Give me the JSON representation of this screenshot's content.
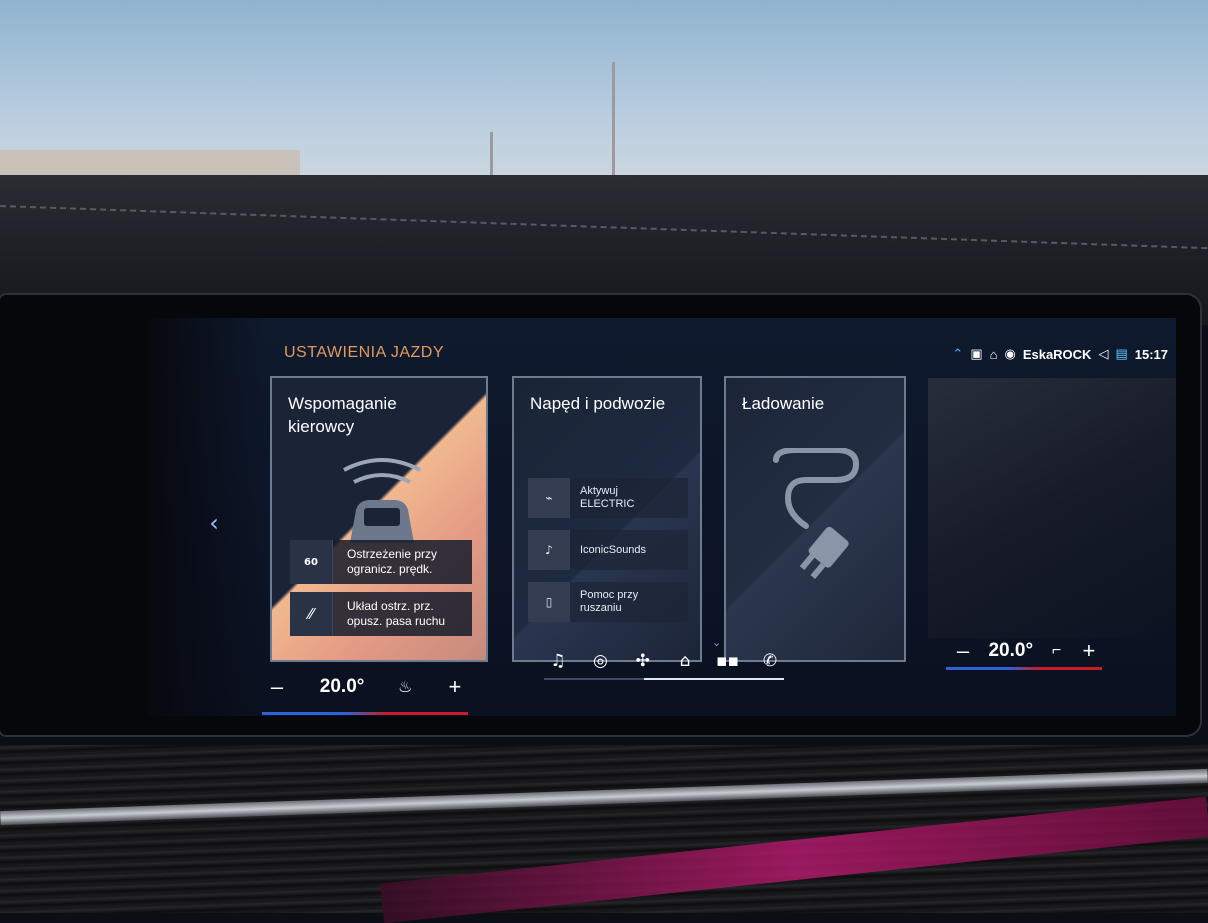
{
  "header": {
    "title": "USTAWIENIA JAZDY"
  },
  "status_bar": {
    "icons": [
      "connectivity-icon",
      "notification-icon",
      "car-icon",
      "radio-icon"
    ],
    "radio_station": "EskaROCK",
    "volume_icon": "speaker-icon",
    "phone_icon": "phone-battery-icon",
    "time": "15:17"
  },
  "cards": [
    {
      "title": "Wspomaganie kierowcy",
      "features": [
        {
          "icon": "speed-limit-icon",
          "icon_glyph": "60",
          "label": "Ostrzeżenie przy\nogranicz. prędk."
        },
        {
          "icon": "lane-departure-icon",
          "icon_glyph": "⁄⁄",
          "label": "Układ ostrz. prz.\nopusz. pasa ruchu"
        }
      ]
    },
    {
      "title": "Napęd i podwozie",
      "features": [
        {
          "icon": "electric-car-icon",
          "icon_glyph": "⌁",
          "label": "Aktywuj\nELECTRIC"
        },
        {
          "icon": "iconic-sounds-icon",
          "icon_glyph": "♪",
          "label": "IconicSounds"
        },
        {
          "icon": "start-assist-icon",
          "icon_glyph": "▯",
          "label": "Pomoc przy\nruszaniu"
        }
      ]
    },
    {
      "title": "Ładowanie",
      "icon": "charging-plug-icon"
    }
  ],
  "dock": {
    "items": [
      "music-icon",
      "navigation-icon",
      "fan-icon",
      "home-icon",
      "apps-icon",
      "phone-icon"
    ],
    "active": "home-icon"
  },
  "climate": {
    "left": {
      "minus": "–",
      "temp": "20.0°",
      "plus": "+",
      "seat_icon": "heated-seat-icon"
    },
    "right": {
      "minus": "–",
      "temp": "20.0°",
      "plus": "+",
      "seat_icon": "seat-icon"
    }
  },
  "colors": {
    "accent_title": "#e39a5a",
    "screen_bg": "#0f1a2e",
    "cold": "#2d62d8",
    "hot": "#c81d26"
  }
}
